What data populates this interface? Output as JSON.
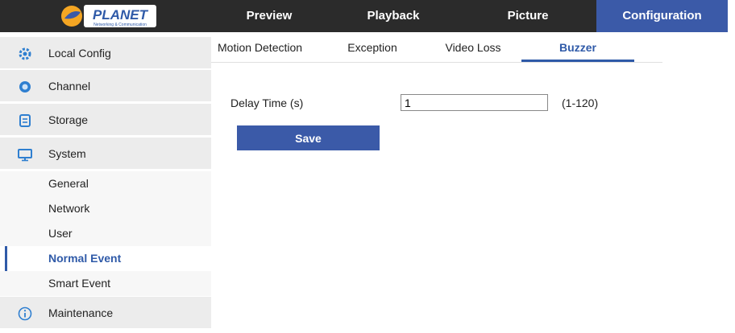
{
  "brand": {
    "logo_text": "PLANET",
    "logo_tagline": "Networking & Communication",
    "logo_color": "#2f5aa8"
  },
  "topnav": {
    "items": [
      {
        "label": "Preview"
      },
      {
        "label": "Playback"
      },
      {
        "label": "Picture"
      },
      {
        "label": "Configuration",
        "active": true
      }
    ],
    "active_color": "#3b5aa8"
  },
  "sidebar": {
    "items": [
      {
        "label": "Local Config",
        "icon": "gear-icon"
      },
      {
        "label": "Channel",
        "icon": "camera-icon"
      },
      {
        "label": "Storage",
        "icon": "storage-icon"
      },
      {
        "label": "System",
        "icon": "monitor-icon"
      },
      {
        "label": "Maintenance",
        "icon": "info-icon"
      }
    ],
    "subitems": [
      {
        "label": "General"
      },
      {
        "label": "Network"
      },
      {
        "label": "User"
      },
      {
        "label": "Normal Event",
        "active": true
      },
      {
        "label": "Smart Event"
      }
    ]
  },
  "tabs": [
    {
      "label": "Motion Detection"
    },
    {
      "label": "Exception"
    },
    {
      "label": "Video Loss"
    },
    {
      "label": "Buzzer",
      "active": true
    }
  ],
  "form": {
    "delay_label": "Delay Time (s)",
    "delay_value": "1",
    "delay_range": "(1-120)",
    "save_label": "Save"
  }
}
